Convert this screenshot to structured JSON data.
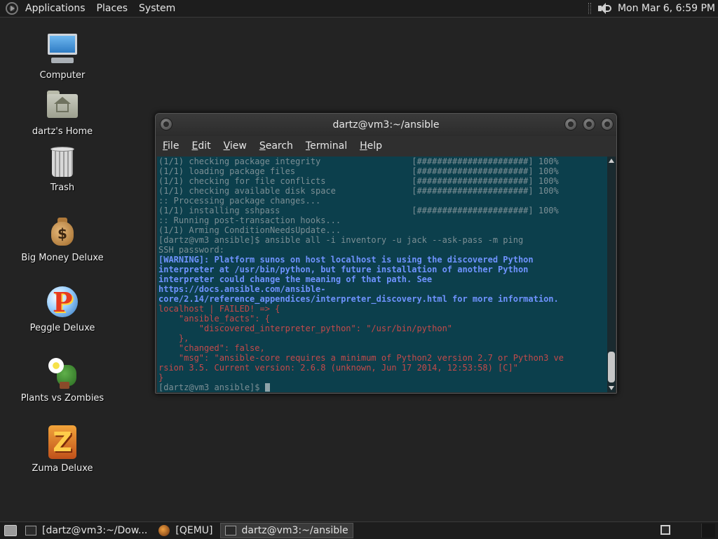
{
  "top_panel": {
    "menus": [
      "Applications",
      "Places",
      "System"
    ],
    "clock": "Mon Mar  6,  6:59 PM"
  },
  "desktop_icons": [
    {
      "label": "Computer",
      "icon": "computer-icon"
    },
    {
      "label": "dartz's Home",
      "icon": "home-folder-icon"
    },
    {
      "label": "Trash",
      "icon": "trash-icon"
    },
    {
      "label": "Big Money Deluxe",
      "icon": "money-bag-icon"
    },
    {
      "label": "Peggle Deluxe",
      "icon": "peggle-icon"
    },
    {
      "label": "Plants vs Zombies",
      "icon": "plants-vs-zombies-icon"
    },
    {
      "label": "Zuma Deluxe",
      "icon": "zuma-icon"
    }
  ],
  "terminal": {
    "title": "dartz@vm3:~/ansible",
    "menu": [
      "File",
      "Edit",
      "View",
      "Search",
      "Terminal",
      "Help"
    ],
    "lines": [
      {
        "t": "(1/1) checking package integrity                  [######################] 100%",
        "c": ""
      },
      {
        "t": "(1/1) loading package files                       [######################] 100%",
        "c": ""
      },
      {
        "t": "(1/1) checking for file conflicts                 [######################] 100%",
        "c": ""
      },
      {
        "t": "(1/1) checking available disk space               [######################] 100%",
        "c": ""
      },
      {
        "t": ":: Processing package changes...",
        "c": ""
      },
      {
        "t": "(1/1) installing sshpass                          [######################] 100%",
        "c": ""
      },
      {
        "t": ":: Running post-transaction hooks...",
        "c": ""
      },
      {
        "t": "(1/1) Arming ConditionNeedsUpdate...",
        "c": ""
      },
      {
        "t": "[dartz@vm3 ansible]$ ansible all -i inventory -u jack --ask-pass -m ping",
        "c": ""
      },
      {
        "t": "SSH password:",
        "c": ""
      },
      {
        "t": "[WARNING]: Platform sunos on host localhost is using the discovered Python",
        "c": "warn"
      },
      {
        "t": "interpreter at /usr/bin/python, but future installation of another Python",
        "c": "warn"
      },
      {
        "t": "interpreter could change the meaning of that path. See",
        "c": "warn"
      },
      {
        "t": "https://docs.ansible.com/ansible-",
        "c": "warn"
      },
      {
        "t": "core/2.14/reference_appendices/interpreter_discovery.html for more information.",
        "c": "warn"
      },
      {
        "t": "localhost | FAILED! => {",
        "c": "fail"
      },
      {
        "t": "    \"ansible_facts\": {",
        "c": "fail"
      },
      {
        "t": "        \"discovered_interpreter_python\": \"/usr/bin/python\"",
        "c": "fail"
      },
      {
        "t": "    },",
        "c": "fail"
      },
      {
        "t": "    \"changed\": false,",
        "c": "fail"
      },
      {
        "t": "    \"msg\": \"ansible-core requires a minimum of Python2 version 2.7 or Python3 ve",
        "c": "fail"
      },
      {
        "t": "rsion 3.5. Current version: 2.6.8 (unknown, Jun 17 2014, 12:53:58) [C]\"",
        "c": "fail"
      },
      {
        "t": "}",
        "c": "fail"
      },
      {
        "t": "[dartz@vm3 ansible]$ ",
        "c": "prompt"
      }
    ]
  },
  "taskbar": {
    "tasks": [
      {
        "label": "[dartz@vm3:~/Dow...",
        "icon": "terminal-icon",
        "active": false
      },
      {
        "label": "[QEMU]",
        "icon": "qemu-icon",
        "active": false
      },
      {
        "label": "dartz@vm3:~/ansible",
        "icon": "terminal-icon",
        "active": true
      }
    ]
  },
  "colors": {
    "desktop_bg": "#232323",
    "terminal_bg": "#0c3f4c",
    "terminal_fg": "#7c8f95",
    "warning_fg": "#6f93ff",
    "failed_fg": "#c44a4a"
  }
}
